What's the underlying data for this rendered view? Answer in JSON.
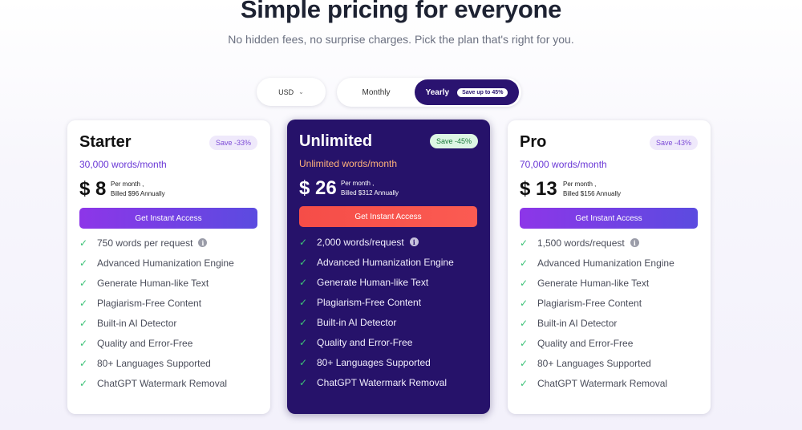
{
  "header": {
    "title": "Simple pricing for everyone",
    "subtitle": "No hidden fees, no surprise charges. Pick the plan that's right for you."
  },
  "currency": {
    "selected": "USD",
    "icon": "chevron-down-icon"
  },
  "billing": {
    "monthly_label": "Monthly",
    "yearly_label": "Yearly",
    "yearly_badge": "Save up to 45%",
    "selected": "Yearly",
    "active_color": "#2a1370"
  },
  "plans": [
    {
      "name": "Starter",
      "save": "Save -33%",
      "words": "30,000 words/month",
      "price": "$ 8",
      "per_month": "Per month ,",
      "billed": "Billed $96 Annually",
      "cta": "Get Instant Access",
      "features": [
        "750 words per request",
        "Advanced Humanization Engine",
        "Generate Human-like Text",
        "Plagiarism-Free Content",
        "Built-in AI Detector",
        "Quality and Error-Free",
        "80+ Languages Supported",
        "ChatGPT Watermark Removal"
      ]
    },
    {
      "name": "Unlimited",
      "save": "Save -45%",
      "words": "Unlimited words/month",
      "price": "$ 26",
      "per_month": "Per month ,",
      "billed": "Billed $312 Annually",
      "cta": "Get Instant Access",
      "features": [
        "2,000 words/request",
        "Advanced Humanization Engine",
        "Generate Human-like Text",
        "Plagiarism-Free Content",
        "Built-in AI Detector",
        "Quality and Error-Free",
        "80+ Languages Supported",
        "ChatGPT Watermark Removal"
      ]
    },
    {
      "name": "Pro",
      "save": "Save -43%",
      "words": "70,000 words/month",
      "price": "$ 13",
      "per_month": "Per month ,",
      "billed": "Billed $156 Annually",
      "cta": "Get Instant Access",
      "features": [
        "1,500 words/request",
        "Advanced Humanization Engine",
        "Generate Human-like Text",
        "Plagiarism-Free Content",
        "Built-in AI Detector",
        "Quality and Error-Free",
        "80+ Languages Supported",
        "ChatGPT Watermark Removal"
      ]
    }
  ],
  "icons": {
    "feature": "check-icon",
    "info": "info-icon"
  },
  "colors": {
    "highlight_card": "#26126a",
    "cta_gradient_start": "#8d36e8",
    "cta_gradient_end": "#5b4be0",
    "highlight_cta": "#f54d48",
    "check": "#3cc277"
  }
}
